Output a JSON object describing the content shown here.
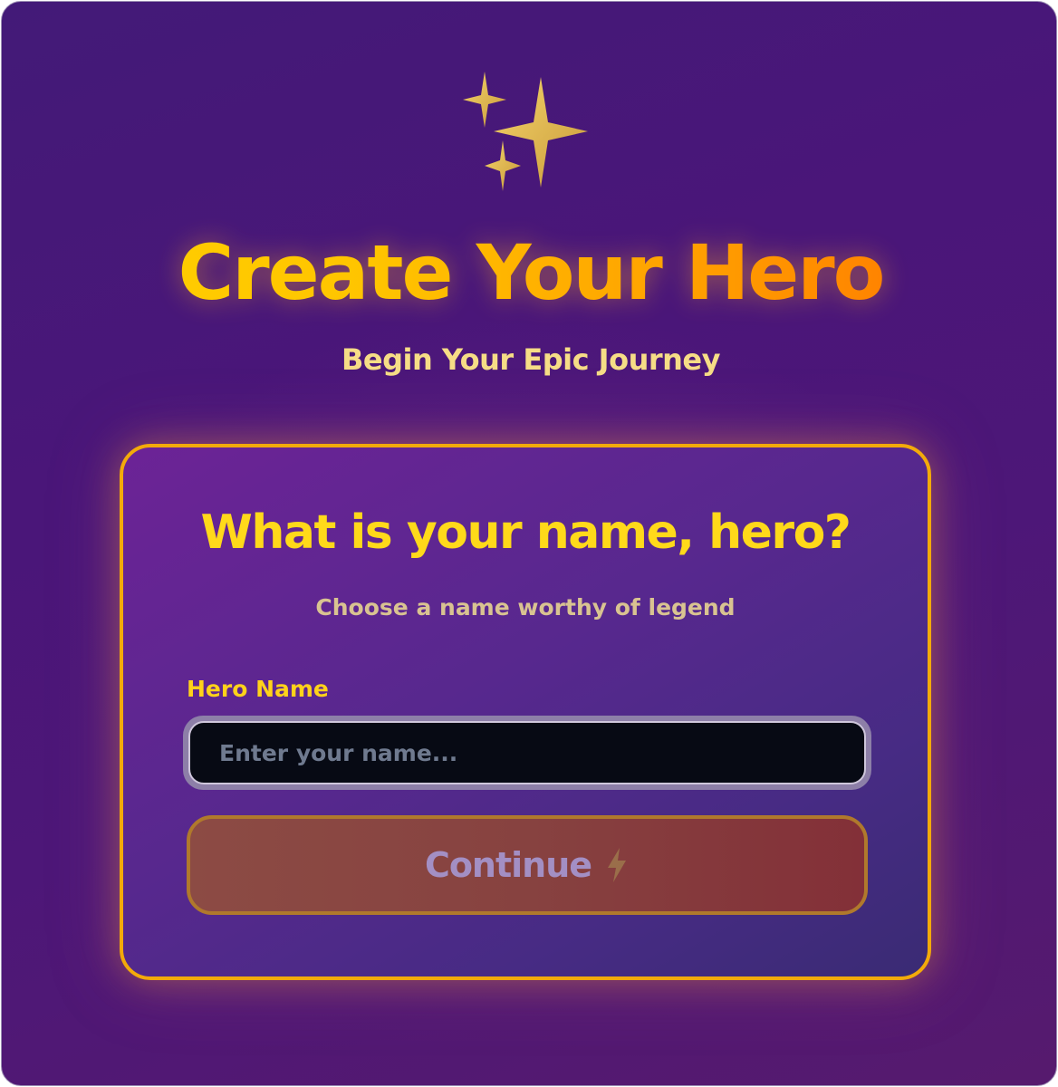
{
  "header": {
    "icon": "sparkles-icon",
    "title": "Create Your Hero",
    "subtitle": "Begin Your Epic Journey"
  },
  "form": {
    "heading": "What is your name, hero?",
    "description": "Choose a name worthy of legend",
    "name_label": "Hero Name",
    "name_value": "",
    "name_placeholder": "Enter your name...",
    "continue_label": "Continue",
    "continue_icon": "lightning-bolt-icon",
    "continue_disabled": true
  },
  "colors": {
    "background": "#4a1679",
    "accent_gold": "#ffd21a",
    "title_gradient_end": "#ff6a00",
    "card_border": "#f3aa0a",
    "button": "#874240"
  }
}
